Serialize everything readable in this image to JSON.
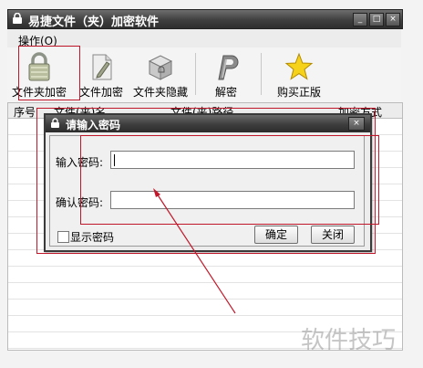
{
  "window": {
    "title": "易捷文件（夹）加密软件",
    "min": "_",
    "max": "□",
    "close": "×"
  },
  "menu": {
    "items": [
      {
        "label": "操作(O)"
      }
    ]
  },
  "toolbar": {
    "items": [
      {
        "label": "文件夹加密",
        "icon": "lock-icon"
      },
      {
        "label": "文件加密",
        "icon": "pencil-document-icon"
      },
      {
        "label": "文件夹隐藏",
        "icon": "box-icon"
      },
      {
        "label": "解密",
        "icon": "p-logo-icon"
      },
      {
        "label": "购买正版",
        "icon": "star-icon"
      }
    ]
  },
  "grid": {
    "columns": [
      "序号",
      "文件(夹)名",
      "文件(夹)路径",
      "加密方式"
    ]
  },
  "dialog": {
    "title": "请输入密码",
    "close": "×",
    "password_label": "输入密码:",
    "password_value": "",
    "confirm_label": "确认密码:",
    "confirm_value": "",
    "show_password_label": "显示密码",
    "show_password_checked": false,
    "ok_label": "确定",
    "close_label": "关闭"
  },
  "watermark": "软件技巧",
  "colors": {
    "annotation": "#c0182a",
    "titlebar": "#3f3f3f"
  }
}
